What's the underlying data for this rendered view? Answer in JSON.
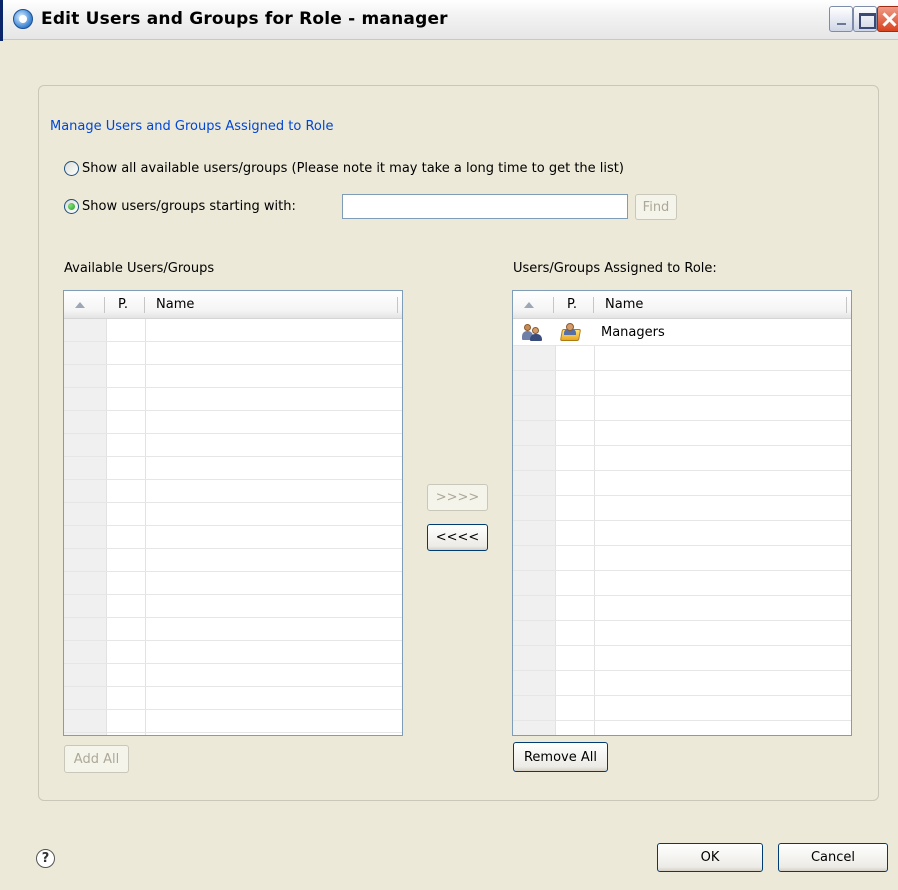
{
  "window": {
    "title": "Edit Users and Groups for Role - manager"
  },
  "group": {
    "legend": "Manage Users and Groups Assigned to Role"
  },
  "options": {
    "show_all_label": "Show all available users/groups (Please note it may take a long time to get the list)",
    "show_all_checked": false,
    "show_starting_label": "Show users/groups starting with:",
    "show_starting_checked": true,
    "search_value": "",
    "find_label": "Find"
  },
  "available": {
    "label": "Available Users/Groups",
    "columns": [
      "",
      "P.",
      "Name"
    ],
    "rows": [],
    "add_all_label": "Add All"
  },
  "transfer": {
    "add_label": ">>>>",
    "remove_label": "<<<<"
  },
  "assigned": {
    "label": "Users/Groups Assigned to Role:",
    "columns": [
      "",
      "P.",
      "Name"
    ],
    "rows": [
      {
        "type_icon": "group-icon",
        "provider_icon": "folder-user-icon",
        "name": "Managers"
      }
    ],
    "remove_all_label": "Remove All"
  },
  "footer": {
    "ok_label": "OK",
    "cancel_label": "Cancel"
  }
}
